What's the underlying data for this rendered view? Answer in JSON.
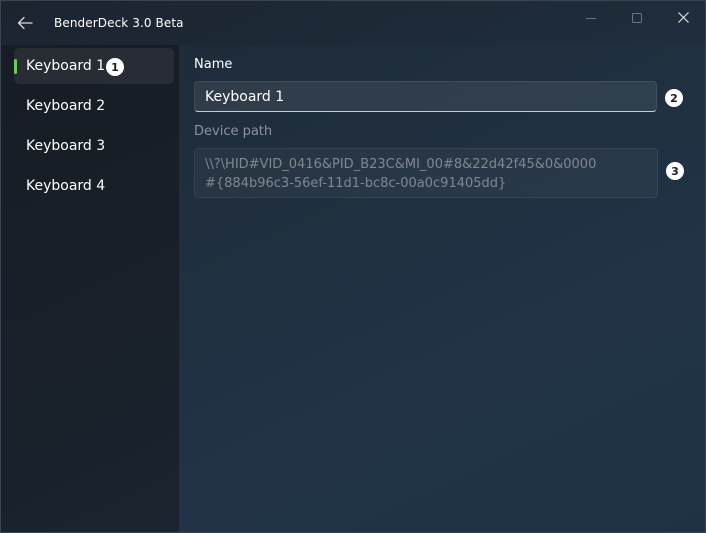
{
  "titlebar": {
    "title": "BenderDeck 3.0 Beta",
    "back_icon": "arrow-left-icon",
    "minimize_icon": "minimize-icon",
    "maximize_icon": "maximize-icon",
    "close_icon": "close-icon"
  },
  "sidebar": {
    "items": [
      {
        "label": "Keyboard 1",
        "selected": true,
        "badge": "1"
      },
      {
        "label": "Keyboard 2",
        "selected": false
      },
      {
        "label": "Keyboard 3",
        "selected": false
      },
      {
        "label": "Keyboard 4",
        "selected": false
      }
    ],
    "accent_color": "#6ccb5f"
  },
  "main": {
    "name_label": "Name",
    "name_value": "Keyboard 1",
    "name_badge": "2",
    "path_label": "Device path",
    "path_value": "\\\\?\\HID#VID_0416&PID_B23C&MI_00#8&22d42f45&0&0000\n#{884b96c3-56ef-11d1-bc8c-00a0c91405dd}",
    "path_badge": "3"
  }
}
